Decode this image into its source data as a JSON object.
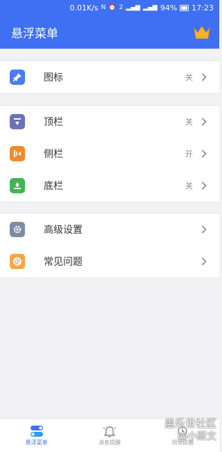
{
  "status_bar": {
    "speed": "0.01K/s",
    "battery": "94%",
    "time": "17:23"
  },
  "app": {
    "title": "悬浮菜单"
  },
  "groups": [
    {
      "items": [
        {
          "label": "图标",
          "value": "关",
          "icon": "pin-icon",
          "color": "#4a7cf3"
        }
      ]
    },
    {
      "items": [
        {
          "label": "顶栏",
          "value": "关",
          "icon": "top-bar-icon",
          "color": "#6a73b5"
        },
        {
          "label": "侧栏",
          "value": "开",
          "icon": "side-bar-icon",
          "color": "#f08b2a"
        },
        {
          "label": "底栏",
          "value": "关",
          "icon": "bottom-bar-icon",
          "color": "#43b357"
        }
      ]
    },
    {
      "items": [
        {
          "label": "高级设置",
          "value": "",
          "icon": "gear-icon",
          "color": "#7c8ba6"
        },
        {
          "label": "常见问题",
          "value": "",
          "icon": "lifebuoy-icon",
          "color": "#f5a647"
        }
      ]
    }
  ],
  "tabs": [
    {
      "label": "悬浮菜单",
      "icon": "toggle-icon",
      "active": true
    },
    {
      "label": "消息提醒",
      "icon": "bell-icon",
      "active": false
    },
    {
      "label": "领导提醒",
      "icon": "reminder-icon",
      "active": false
    }
  ],
  "watermark": {
    "line1": "盖乐世社区",
    "line2": "@小斯文"
  },
  "colors": {
    "primary": "#3f6ff2",
    "background": "#f2f2f4"
  }
}
